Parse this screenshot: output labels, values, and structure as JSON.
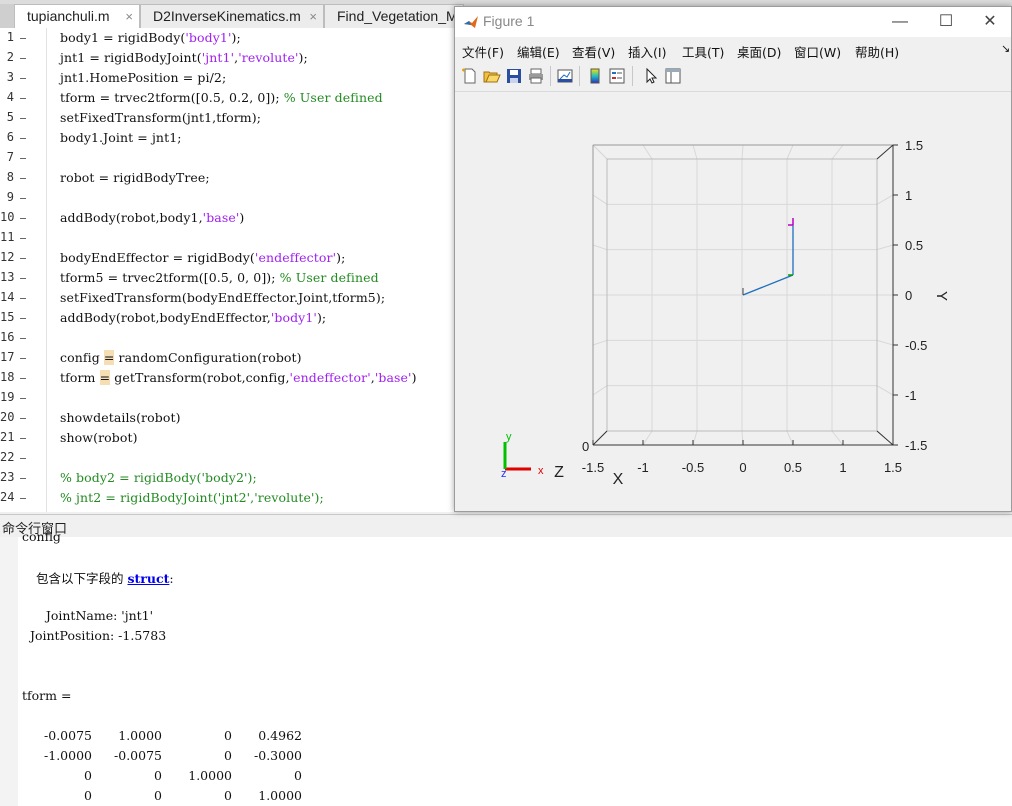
{
  "editor": {
    "tabs": [
      {
        "label": "tupianchuli.m"
      },
      {
        "label": "D2InverseKinematics.m"
      },
      {
        "label": "Find_Vegetation_Mu"
      }
    ],
    "close_glyph": "×",
    "line_numbers": [
      "1",
      "2",
      "3",
      "4",
      "5",
      "6",
      "7",
      "8",
      "9",
      "10",
      "11",
      "12",
      "13",
      "14",
      "15",
      "16",
      "17",
      "18",
      "19",
      "20",
      "21",
      "22",
      "23",
      "24"
    ],
    "lines": {
      "l1a": "body1 = rigidBody(",
      "l1s": "'body1'",
      "l1b": ");",
      "l2a": "jnt1 = rigidBodyJoint(",
      "l2s1": "'jnt1'",
      "l2c": ",",
      "l2s2": "'revolute'",
      "l2b": ");",
      "l3": "jnt1.HomePosition = pi/2;",
      "l4a": "tform = trvec2tform([0.5, 0.2, 0]); ",
      "l4c": "% User defined",
      "l5": "setFixedTransform(jnt1,tform);",
      "l6": "body1.Joint = jnt1;",
      "l8": "robot = rigidBodyTree;",
      "l10a": "addBody(robot,body1,",
      "l10s": "'base'",
      "l10b": ")",
      "l12a": "bodyEndEffector = rigidBody(",
      "l12s": "'endeffector'",
      "l12b": ");",
      "l13a": "tform5 = trvec2tform([0.5, 0, 0]); ",
      "l13c": "% User defined",
      "l14": "setFixedTransform(bodyEndEffector.Joint,tform5);",
      "l15a": "addBody(robot,bodyEndEffector,",
      "l15s": "'body1'",
      "l15b": ");",
      "l17a": "config ",
      "l17h": "=",
      "l17b": " randomConfiguration(robot)",
      "l18a": "tform ",
      "l18h": "=",
      "l18b": " getTransform(robot,config,",
      "l18s1": "'endeffector'",
      "l18c": ",",
      "l18s2": "'base'",
      "l18d": ")",
      "l20": "showdetails(robot)",
      "l21": "show(robot)",
      "l23": "% body2 = rigidBody('body2');",
      "l24": "% jnt2 = rigidBodyJoint('jnt2','revolute');"
    }
  },
  "command_window": {
    "title": "命令行窗口",
    "partial_top": "config",
    "struct_prefix": "包含以下字段的 ",
    "struct_link": "struct",
    "struct_suffix": ":",
    "field1": "      JointName: 'jnt1'",
    "field2": "  JointPosition: -1.5783",
    "tform_label": "tform =",
    "matrix": [
      [
        "-0.0075",
        "1.0000",
        "0",
        "0.4962"
      ],
      [
        "-1.0000",
        "-0.0075",
        "0",
        "-0.3000"
      ],
      [
        "0",
        "0",
        "1.0000",
        "0"
      ],
      [
        "0",
        "0",
        "0",
        "1.0000"
      ]
    ]
  },
  "figure": {
    "title": "Figure 1",
    "window_buttons": {
      "minimize": "—",
      "maximize": "☐",
      "close": "✕"
    },
    "menus": [
      "文件(F)",
      "编辑(E)",
      "查看(V)",
      "插入(I)",
      "工具(T)",
      "桌面(D)",
      "窗口(W)",
      "帮助(H)"
    ],
    "menu_more": "↘",
    "toolbar_icons": [
      "new-figure-icon",
      "open-file-icon",
      "save-icon",
      "print-icon",
      "link-plot-icon",
      "insert-colorbar-icon",
      "insert-legend-icon",
      "edit-plot-icon",
      "property-inspector-icon"
    ],
    "colors": {
      "robot_link": "#1f6fbf",
      "joint_magenta": "#c000c0",
      "joint_green": "#00a000",
      "grid": "#d8d8d8",
      "triad_x": "#e00000",
      "triad_y": "#00c000",
      "triad_z": "#2030ff"
    },
    "axes": {
      "x_ticks": [
        "-1.5",
        "-1",
        "-0.5",
        "0",
        "0.5",
        "1",
        "1.5"
      ],
      "y_ticks": [
        "1.5",
        "1",
        "0.5",
        "0",
        "-0.5",
        "-1",
        "-1.5"
      ],
      "xlabel": "X",
      "ylabel": "Y",
      "zlabel": "Z",
      "corner_tick": "0",
      "xlim": [
        -1.5,
        1.5
      ],
      "ylim": [
        -1.5,
        1.5
      ]
    },
    "robot": {
      "base": [
        0,
        0
      ],
      "joint": [
        0.5,
        0.2
      ],
      "end_effector": [
        0.5,
        0.7
      ]
    },
    "triad_labels": {
      "x": "x",
      "y": "y",
      "z": "z"
    }
  }
}
